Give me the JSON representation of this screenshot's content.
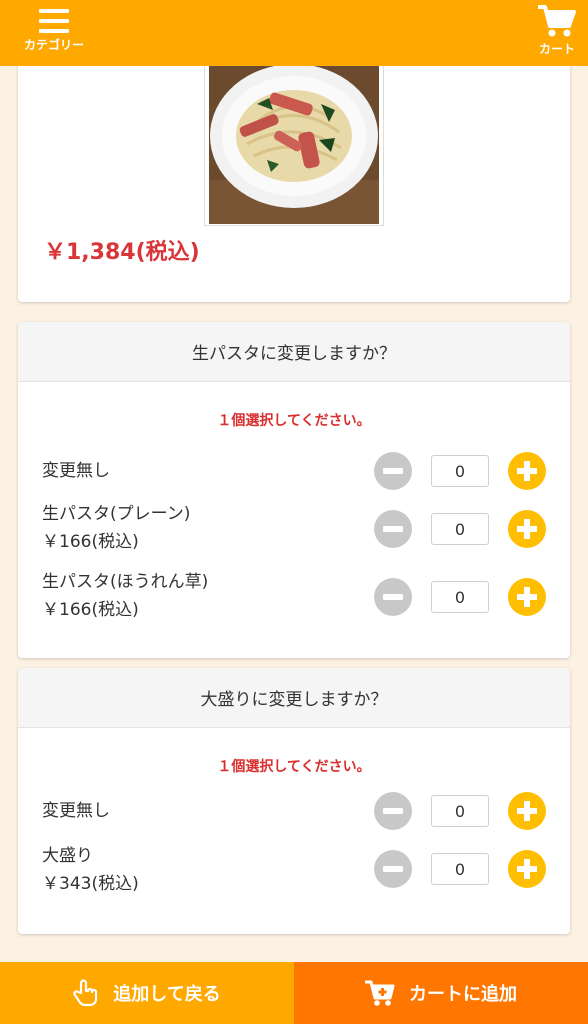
{
  "header": {
    "menu_label": "カテゴリー",
    "cart_label": "カート"
  },
  "product": {
    "price": "￥1,384(税込)"
  },
  "option_groups": [
    {
      "title": "生パスタに変更しますか？",
      "notice": "１個選択してください。",
      "options": [
        {
          "name": "変更無し",
          "price": "",
          "qty": "0"
        },
        {
          "name": "生パスタ(プレーン)",
          "price": "￥166(税込)",
          "qty": "0"
        },
        {
          "name": "生パスタ(ほうれん草)",
          "price": "￥166(税込)",
          "qty": "0"
        }
      ]
    },
    {
      "title": "大盛りに変更しますか？",
      "notice": "１個選択してください。",
      "options": [
        {
          "name": "変更無し",
          "price": "",
          "qty": "0"
        },
        {
          "name": "大盛り",
          "price": "￥343(税込)",
          "qty": "0"
        }
      ]
    }
  ],
  "footer": {
    "back_label": "追加して戻る",
    "add_label": "カートに追加"
  },
  "colors": {
    "header": "#ffa800",
    "price": "#d9363a",
    "notice": "#d92f2f",
    "plus": "#ffbf00",
    "add_to_cart": "#ff7700"
  }
}
